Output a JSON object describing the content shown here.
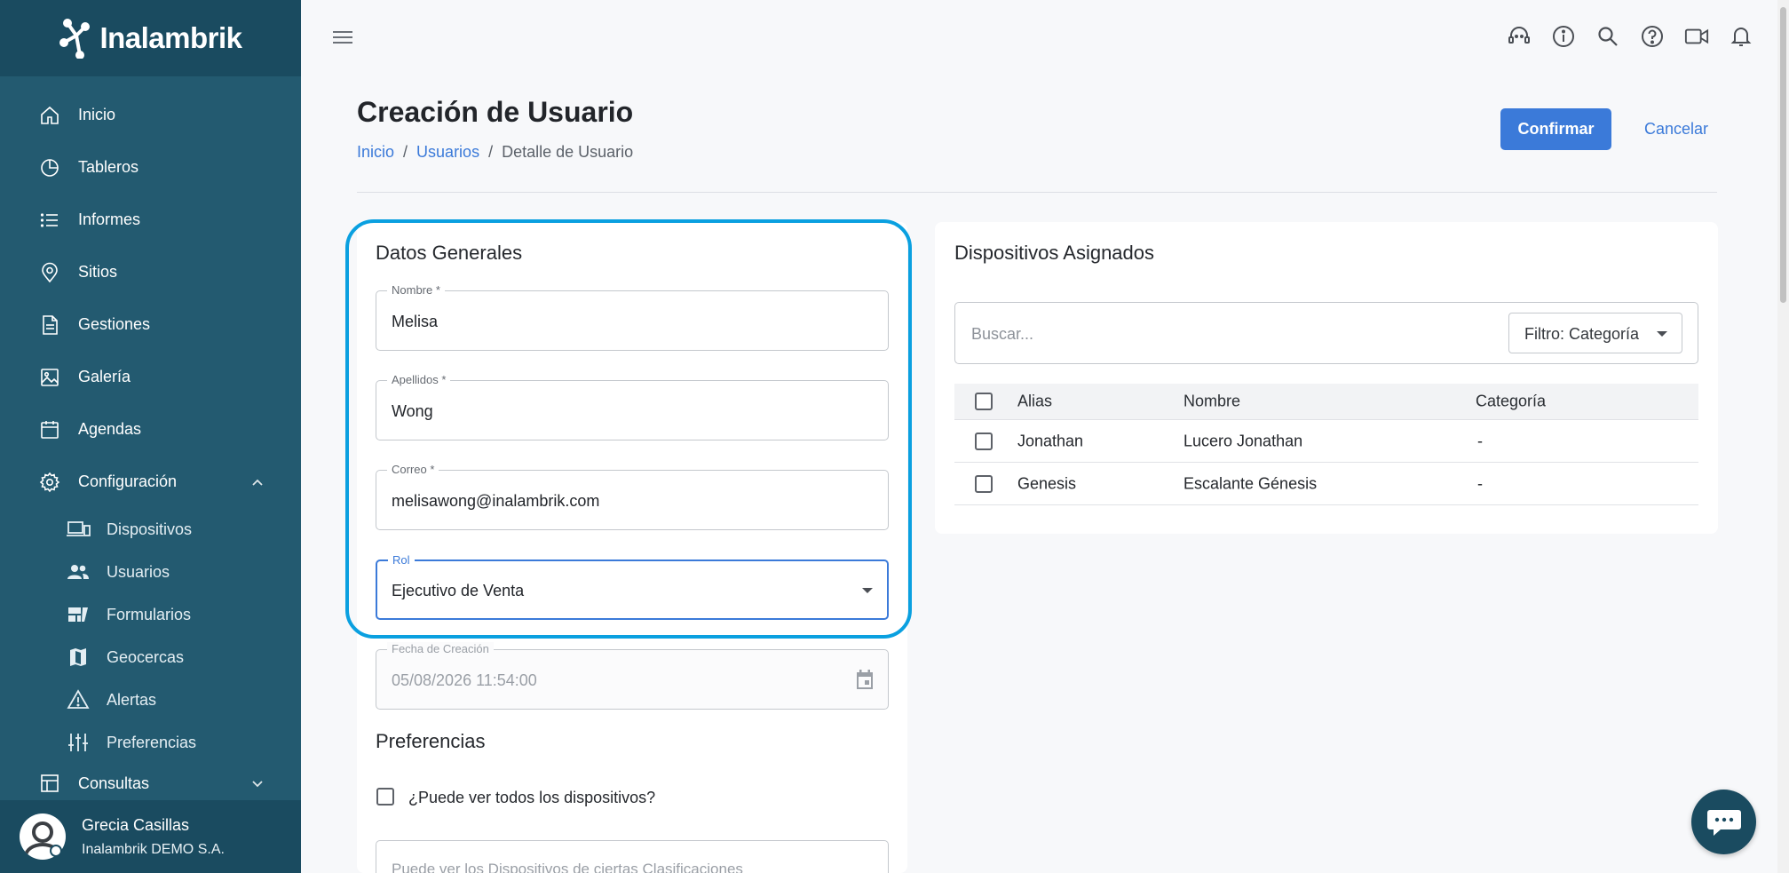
{
  "brand": {
    "name": "Inalambrik"
  },
  "sidebar": {
    "items": [
      {
        "label": "Inicio",
        "icon": "home-icon"
      },
      {
        "label": "Tableros",
        "icon": "pie-chart-icon"
      },
      {
        "label": "Informes",
        "icon": "list-icon"
      },
      {
        "label": "Sitios",
        "icon": "map-pin-icon"
      },
      {
        "label": "Gestiones",
        "icon": "document-icon"
      },
      {
        "label": "Galería",
        "icon": "image-icon"
      },
      {
        "label": "Agendas",
        "icon": "calendar-icon"
      },
      {
        "label": "Configuración",
        "icon": "gear-icon"
      }
    ],
    "subitems": [
      {
        "label": "Dispositivos",
        "icon": "devices-icon"
      },
      {
        "label": "Usuarios",
        "icon": "users-icon"
      },
      {
        "label": "Formularios",
        "icon": "forms-icon"
      },
      {
        "label": "Geocercas",
        "icon": "map-icon"
      },
      {
        "label": "Alertas",
        "icon": "warning-icon"
      },
      {
        "label": "Preferencias",
        "icon": "sliders-icon"
      }
    ],
    "consultas": {
      "label": "Consultas",
      "icon": "table-icon"
    },
    "user": {
      "name": "Grecia Casillas",
      "org": "Inalambrik DEMO S.A."
    }
  },
  "header": {
    "title": "Creación de Usuario",
    "breadcrumb": [
      "Inicio",
      "Usuarios",
      "Detalle de Usuario"
    ],
    "breadcrumb_sep": "/",
    "confirm_label": "Confirmar",
    "cancel_label": "Cancelar"
  },
  "general": {
    "title": "Datos Generales",
    "fields": {
      "nombre": {
        "label": "Nombre *",
        "value": "Melisa"
      },
      "apellidos": {
        "label": "Apellidos *",
        "value": "Wong"
      },
      "correo": {
        "label": "Correo *",
        "value": "melisawong@inalambrik.com"
      },
      "rol": {
        "label": "Rol",
        "value": "Ejecutivo de Venta"
      },
      "fecha": {
        "label": "Fecha de Creación",
        "value": "05/08/2026 11:54:00"
      }
    }
  },
  "preferencias": {
    "title": "Preferencias",
    "checkbox_label": "¿Puede ver todos los dispositivos?",
    "classif_placeholder": "Puede ver los Dispositivos de ciertas Clasificaciones"
  },
  "devices": {
    "title": "Dispositivos Asignados",
    "search_placeholder": "Buscar...",
    "filter_label": "Filtro: Categoría",
    "columns": [
      "Alias",
      "Nombre",
      "Categoría"
    ],
    "rows": [
      {
        "alias": "Jonathan",
        "nombre": "Lucero Jonathan",
        "categoria": "-"
      },
      {
        "alias": "Genesis",
        "nombre": "Escalante Génesis",
        "categoria": "-"
      }
    ]
  },
  "colors": {
    "sidebar": "#235a70",
    "sidebar_dark": "#1a4b60",
    "accent": "#3b7ad9",
    "highlight": "#0aa0e0"
  }
}
